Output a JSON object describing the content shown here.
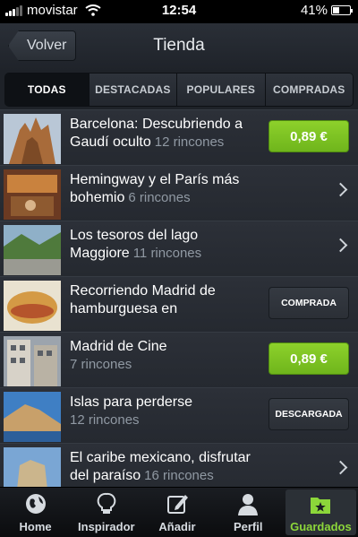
{
  "status_bar": {
    "carrier": "movistar",
    "time": "12:54",
    "battery": "41%",
    "battery_level": 0.41
  },
  "nav": {
    "back_label": "Volver",
    "title": "Tienda"
  },
  "segments": [
    "TODAS",
    "DESTACADAS",
    "POPULARES",
    "COMPRADAS"
  ],
  "items": [
    {
      "title": "Barcelona: Descubriendo a Gaudí oculto",
      "count": "12 rincones",
      "action": "price",
      "action_label": "0,89 €"
    },
    {
      "title": "Hemingway y el París más bohemio",
      "count": "6 rincones",
      "action": "chevron",
      "action_label": ""
    },
    {
      "title": "Los tesoros del lago Maggiore",
      "count": "11 rincones",
      "action": "chevron",
      "action_label": ""
    },
    {
      "title": "Recorriendo Madrid de hamburguesa en",
      "count": "",
      "action": "state",
      "action_label": "COMPRADA"
    },
    {
      "title": "Madrid de Cine",
      "count": "7 rincones",
      "action": "price",
      "action_label": "0,89 €"
    },
    {
      "title": "Islas para perderse",
      "count": "12 rincones",
      "action": "state",
      "action_label": "DESCARGADA"
    },
    {
      "title": "El caribe mexicano, disfrutar del paraíso",
      "count": "16 rincones",
      "action": "chevron",
      "action_label": ""
    }
  ],
  "tabs": [
    {
      "label": "Home",
      "icon": "globe-icon"
    },
    {
      "label": "Inspirador",
      "icon": "lightbulb-icon"
    },
    {
      "label": "Añadir",
      "icon": "pencil-square-icon"
    },
    {
      "label": "Perfil",
      "icon": "person-icon"
    },
    {
      "label": "Guardados",
      "icon": "star-folder-icon"
    }
  ],
  "colors": {
    "price_button": "#7bc223",
    "active_tab": "#8cd63a",
    "list_bg": "#272b32"
  }
}
